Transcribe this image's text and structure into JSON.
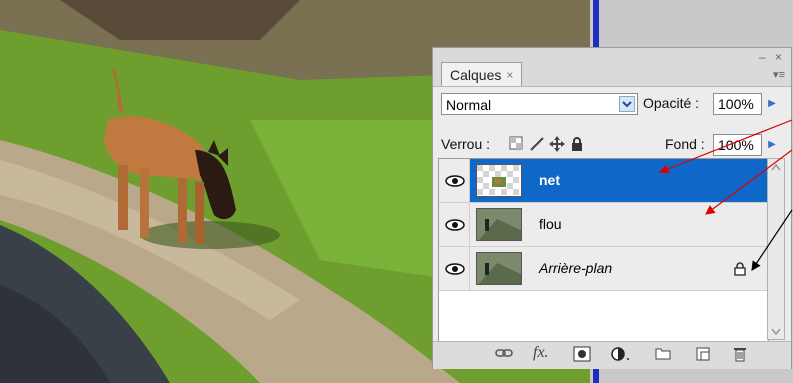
{
  "panel": {
    "tab_label": "Calques",
    "tab_close": "×",
    "window_controls": "– ×",
    "blend_mode": "Normal",
    "opacity_label": "Opacité :",
    "opacity_value": "100%",
    "lock_label": "Verrou :",
    "fill_label": "Fond :",
    "fill_value": "100%"
  },
  "layers": [
    {
      "name": "net",
      "selected": true,
      "visible": true
    },
    {
      "name": "flou",
      "selected": false,
      "visible": true
    },
    {
      "name": "Arrière-plan",
      "selected": false,
      "visible": true,
      "locked": true
    }
  ],
  "icons": [
    "eye-icon",
    "link-icon",
    "fx-icon",
    "mask-icon",
    "adjustment-icon",
    "folder-icon",
    "new-layer-icon",
    "trash-icon",
    "lock-icon",
    "transparency-lock-icon",
    "brush-lock-icon",
    "move-lock-icon"
  ],
  "colors": {
    "selection": "#0f67c8",
    "annotation_red": "#e00000",
    "annotation_black": "#000000"
  }
}
